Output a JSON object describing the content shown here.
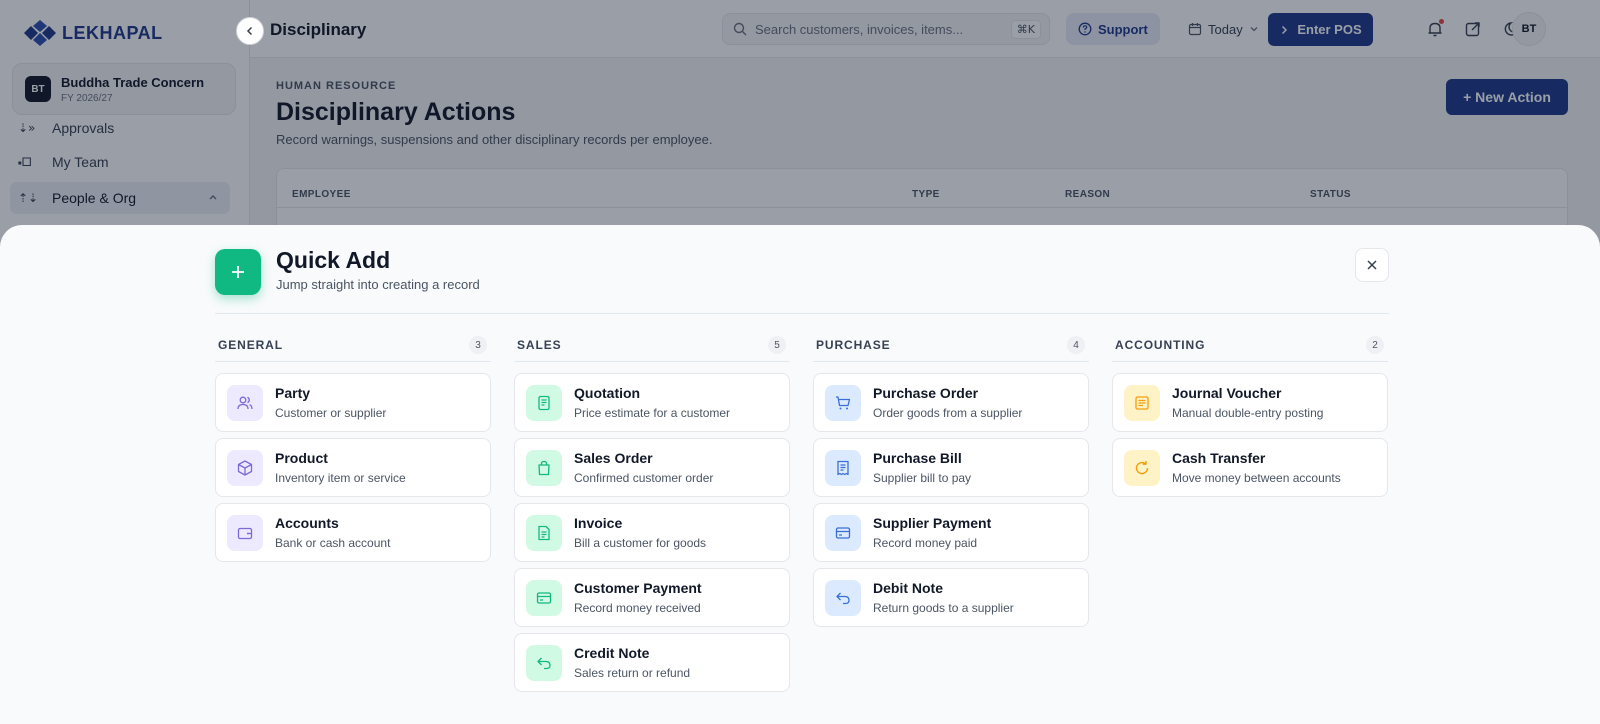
{
  "app": {
    "logo": "LEKHAPAL",
    "org_avatar": "BT",
    "org_name": "Buddha Trade Concern",
    "fiscal_year": "FY 2026/27"
  },
  "sidebar": {
    "items": [
      {
        "label": "Approvals",
        "glyph": "⇣»"
      },
      {
        "label": "My Team",
        "glyph": "🞍🞐"
      },
      {
        "label": "People & Org",
        "glyph": "⇡⇣",
        "active": true
      }
    ]
  },
  "topbar": {
    "title": "Disciplinary",
    "search_placeholder": "Search customers, invoices, items...",
    "shortcut": "⌘K",
    "support_label": "Support",
    "date_filter": "Today",
    "pos_label": "Enter POS",
    "user_initials": "BT"
  },
  "main": {
    "eyebrow": "HUMAN RESOURCE",
    "title": "Disciplinary Actions",
    "subtitle": "Record warnings, suspensions and other disciplinary records per employee.",
    "new_action_label": "+ New Action",
    "table_headers": [
      "EMPLOYEE",
      "TYPE",
      "REASON",
      "STATUS"
    ]
  },
  "quick_add": {
    "title": "Quick Add",
    "subtitle": "Jump straight into creating a record",
    "groups": [
      {
        "name": "GENERAL",
        "count": "3",
        "items": [
          {
            "title": "Party",
            "desc": "Customer or supplier",
            "icon": "users-icon"
          },
          {
            "title": "Product",
            "desc": "Inventory item or service",
            "icon": "box-icon"
          },
          {
            "title": "Accounts",
            "desc": "Bank or cash account",
            "icon": "wallet-icon"
          }
        ]
      },
      {
        "name": "SALES",
        "count": "5",
        "items": [
          {
            "title": "Quotation",
            "desc": "Price estimate for a customer",
            "icon": "document-icon"
          },
          {
            "title": "Sales Order",
            "desc": "Confirmed customer order",
            "icon": "shopping-bag-icon"
          },
          {
            "title": "Invoice",
            "desc": "Bill a customer for goods",
            "icon": "invoice-icon"
          },
          {
            "title": "Customer Payment",
            "desc": "Record money received",
            "icon": "card-icon"
          },
          {
            "title": "Credit Note",
            "desc": "Sales return or refund",
            "icon": "return-arrow-icon"
          }
        ]
      },
      {
        "name": "PURCHASE",
        "count": "4",
        "items": [
          {
            "title": "Purchase Order",
            "desc": "Order goods from a supplier",
            "icon": "cart-icon"
          },
          {
            "title": "Purchase Bill",
            "desc": "Supplier bill to pay",
            "icon": "receipt-icon"
          },
          {
            "title": "Supplier Payment",
            "desc": "Record money paid",
            "icon": "card-icon"
          },
          {
            "title": "Debit Note",
            "desc": "Return goods to a supplier",
            "icon": "return-arrow-icon"
          }
        ]
      },
      {
        "name": "ACCOUNTING",
        "count": "2",
        "items": [
          {
            "title": "Journal Voucher",
            "desc": "Manual double-entry posting",
            "icon": "notes-icon"
          },
          {
            "title": "Cash Transfer",
            "desc": "Move money between accounts",
            "icon": "refresh-icon"
          }
        ]
      }
    ]
  },
  "colors": {
    "brand": "#1e3a8a",
    "accent_green": "#10b981",
    "general_icon": "#7c6ad6",
    "sales_icon": "#10b981",
    "purchase_icon": "#3b6fd8",
    "accounting_icon": "#f59e0b"
  }
}
